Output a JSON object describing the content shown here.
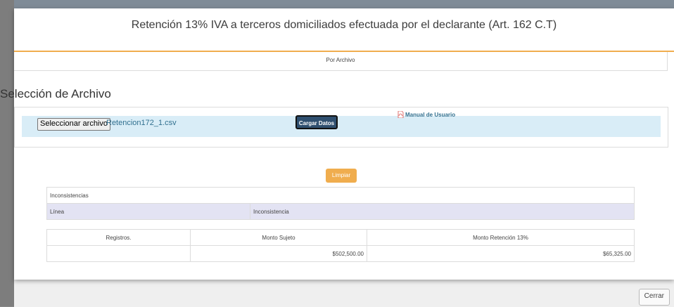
{
  "modal": {
    "title": "Retención 13% IVA a terceros domiciliados efectuada por el declarante (Art. 162 C.T)",
    "tab_label": "Por Archivo",
    "section_title": "Selección de Archivo"
  },
  "upload": {
    "choose_button_label": "Seleccionar archivo",
    "file_name": "Retencion172_1.csv",
    "load_button_label": "Cargar Datos",
    "manual_link_label": "Manual de Usuario",
    "manual_icon": "pdf-icon"
  },
  "clear_button_label": "Limpiar",
  "inconsistencias": {
    "caption": "Inconsistencias",
    "columns": [
      "Línea",
      "Inconsistencia"
    ]
  },
  "totals": {
    "columns": [
      "Registros.",
      "Monto Sujeto",
      "Monto Retención 13%"
    ],
    "row": [
      "",
      "$502,500.00",
      "$65,325.00"
    ]
  },
  "footer": {
    "close_button_label": "Cerrar"
  },
  "colors": {
    "accent": "#f0ad4e",
    "panel_bg": "#d9edf7",
    "header_bg": "#e3e3f3",
    "primary_button": "#2f4f6f"
  }
}
